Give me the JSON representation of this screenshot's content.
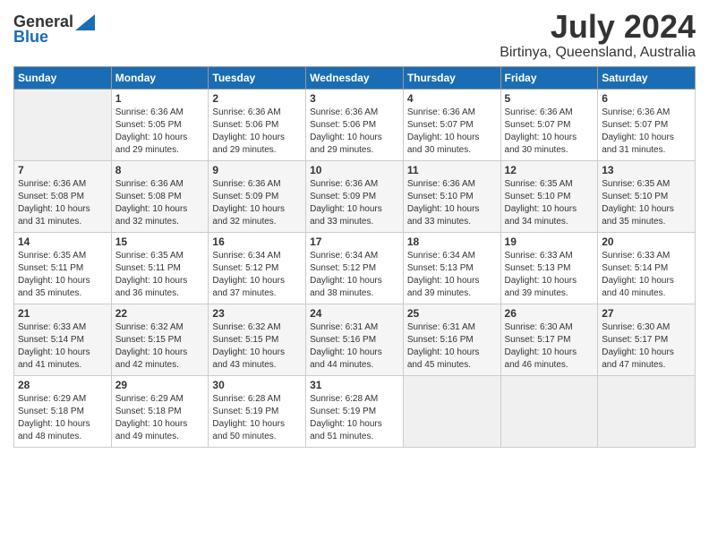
{
  "header": {
    "logo_general": "General",
    "logo_blue": "Blue",
    "month_year": "July 2024",
    "location": "Birtinya, Queensland, Australia"
  },
  "days_of_week": [
    "Sunday",
    "Monday",
    "Tuesday",
    "Wednesday",
    "Thursday",
    "Friday",
    "Saturday"
  ],
  "weeks": [
    [
      {
        "day": "",
        "content": ""
      },
      {
        "day": "1",
        "content": "Sunrise: 6:36 AM\nSunset: 5:05 PM\nDaylight: 10 hours\nand 29 minutes."
      },
      {
        "day": "2",
        "content": "Sunrise: 6:36 AM\nSunset: 5:06 PM\nDaylight: 10 hours\nand 29 minutes."
      },
      {
        "day": "3",
        "content": "Sunrise: 6:36 AM\nSunset: 5:06 PM\nDaylight: 10 hours\nand 29 minutes."
      },
      {
        "day": "4",
        "content": "Sunrise: 6:36 AM\nSunset: 5:07 PM\nDaylight: 10 hours\nand 30 minutes."
      },
      {
        "day": "5",
        "content": "Sunrise: 6:36 AM\nSunset: 5:07 PM\nDaylight: 10 hours\nand 30 minutes."
      },
      {
        "day": "6",
        "content": "Sunrise: 6:36 AM\nSunset: 5:07 PM\nDaylight: 10 hours\nand 31 minutes."
      }
    ],
    [
      {
        "day": "7",
        "content": "Sunrise: 6:36 AM\nSunset: 5:08 PM\nDaylight: 10 hours\nand 31 minutes."
      },
      {
        "day": "8",
        "content": "Sunrise: 6:36 AM\nSunset: 5:08 PM\nDaylight: 10 hours\nand 32 minutes."
      },
      {
        "day": "9",
        "content": "Sunrise: 6:36 AM\nSunset: 5:09 PM\nDaylight: 10 hours\nand 32 minutes."
      },
      {
        "day": "10",
        "content": "Sunrise: 6:36 AM\nSunset: 5:09 PM\nDaylight: 10 hours\nand 33 minutes."
      },
      {
        "day": "11",
        "content": "Sunrise: 6:36 AM\nSunset: 5:10 PM\nDaylight: 10 hours\nand 33 minutes."
      },
      {
        "day": "12",
        "content": "Sunrise: 6:35 AM\nSunset: 5:10 PM\nDaylight: 10 hours\nand 34 minutes."
      },
      {
        "day": "13",
        "content": "Sunrise: 6:35 AM\nSunset: 5:10 PM\nDaylight: 10 hours\nand 35 minutes."
      }
    ],
    [
      {
        "day": "14",
        "content": "Sunrise: 6:35 AM\nSunset: 5:11 PM\nDaylight: 10 hours\nand 35 minutes."
      },
      {
        "day": "15",
        "content": "Sunrise: 6:35 AM\nSunset: 5:11 PM\nDaylight: 10 hours\nand 36 minutes."
      },
      {
        "day": "16",
        "content": "Sunrise: 6:34 AM\nSunset: 5:12 PM\nDaylight: 10 hours\nand 37 minutes."
      },
      {
        "day": "17",
        "content": "Sunrise: 6:34 AM\nSunset: 5:12 PM\nDaylight: 10 hours\nand 38 minutes."
      },
      {
        "day": "18",
        "content": "Sunrise: 6:34 AM\nSunset: 5:13 PM\nDaylight: 10 hours\nand 39 minutes."
      },
      {
        "day": "19",
        "content": "Sunrise: 6:33 AM\nSunset: 5:13 PM\nDaylight: 10 hours\nand 39 minutes."
      },
      {
        "day": "20",
        "content": "Sunrise: 6:33 AM\nSunset: 5:14 PM\nDaylight: 10 hours\nand 40 minutes."
      }
    ],
    [
      {
        "day": "21",
        "content": "Sunrise: 6:33 AM\nSunset: 5:14 PM\nDaylight: 10 hours\nand 41 minutes."
      },
      {
        "day": "22",
        "content": "Sunrise: 6:32 AM\nSunset: 5:15 PM\nDaylight: 10 hours\nand 42 minutes."
      },
      {
        "day": "23",
        "content": "Sunrise: 6:32 AM\nSunset: 5:15 PM\nDaylight: 10 hours\nand 43 minutes."
      },
      {
        "day": "24",
        "content": "Sunrise: 6:31 AM\nSunset: 5:16 PM\nDaylight: 10 hours\nand 44 minutes."
      },
      {
        "day": "25",
        "content": "Sunrise: 6:31 AM\nSunset: 5:16 PM\nDaylight: 10 hours\nand 45 minutes."
      },
      {
        "day": "26",
        "content": "Sunrise: 6:30 AM\nSunset: 5:17 PM\nDaylight: 10 hours\nand 46 minutes."
      },
      {
        "day": "27",
        "content": "Sunrise: 6:30 AM\nSunset: 5:17 PM\nDaylight: 10 hours\nand 47 minutes."
      }
    ],
    [
      {
        "day": "28",
        "content": "Sunrise: 6:29 AM\nSunset: 5:18 PM\nDaylight: 10 hours\nand 48 minutes."
      },
      {
        "day": "29",
        "content": "Sunrise: 6:29 AM\nSunset: 5:18 PM\nDaylight: 10 hours\nand 49 minutes."
      },
      {
        "day": "30",
        "content": "Sunrise: 6:28 AM\nSunset: 5:19 PM\nDaylight: 10 hours\nand 50 minutes."
      },
      {
        "day": "31",
        "content": "Sunrise: 6:28 AM\nSunset: 5:19 PM\nDaylight: 10 hours\nand 51 minutes."
      },
      {
        "day": "",
        "content": ""
      },
      {
        "day": "",
        "content": ""
      },
      {
        "day": "",
        "content": ""
      }
    ]
  ]
}
